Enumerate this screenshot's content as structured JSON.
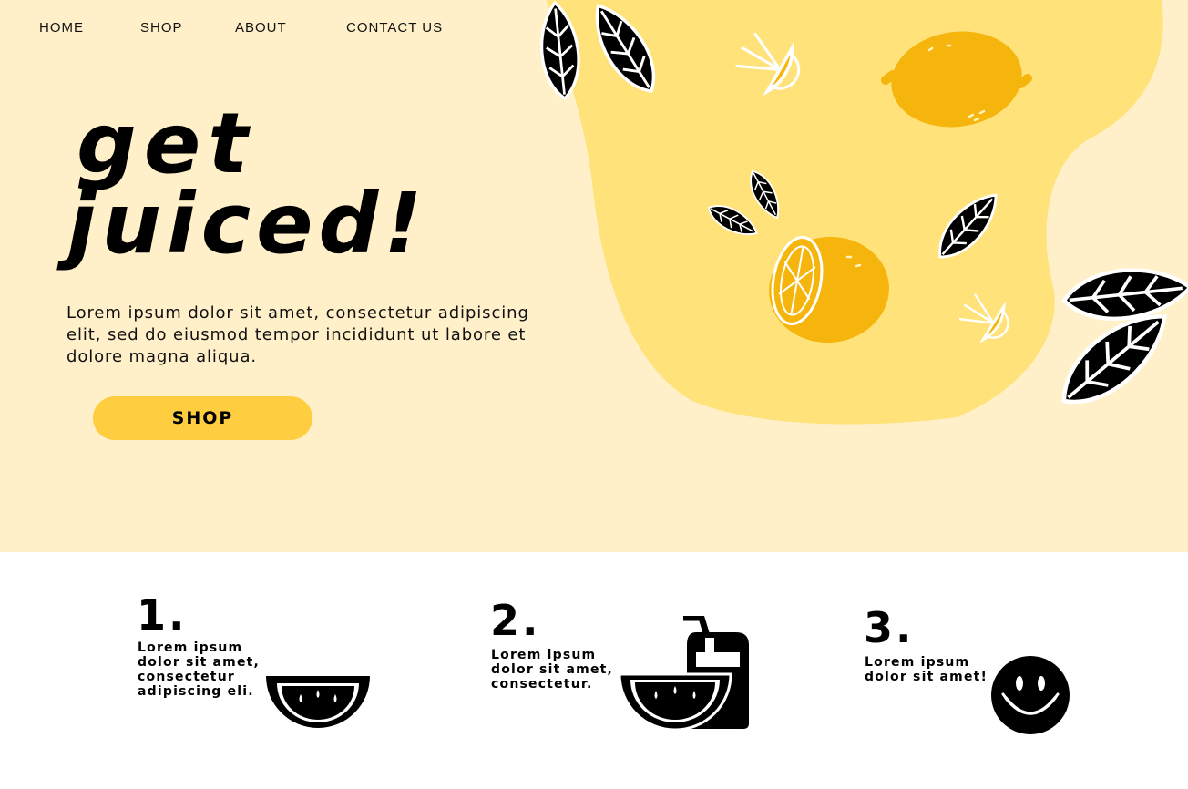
{
  "nav": {
    "home": "HOME",
    "shop": "SHOP",
    "about": "ABOUT",
    "contact": "CONTACT US"
  },
  "hero": {
    "headline_line1": "get",
    "headline_line2": "juiced!",
    "description": "Lorem ipsum dolor sit amet, consectetur adipiscing elit, sed do eiusmod tempor incididunt ut labore et dolore magna aliqua.",
    "cta_label": "SHOP"
  },
  "steps": [
    {
      "number": "1.",
      "text": "Lorem ipsum\ndolor sit amet,\nconsectetur\nadipiscing eli.",
      "icon": "watermelon-slice-icon"
    },
    {
      "number": "2.",
      "text": "Lorem ipsum\ndolor sit amet,\nconsectetur.",
      "icon": "juice-glass-icon"
    },
    {
      "number": "3.",
      "text": "Lorem ipsum\ndolor sit amet!",
      "icon": "smiley-face-icon"
    }
  ],
  "colors": {
    "hero_background": "#fff0c9",
    "blob": "#ffe27a",
    "lemon": "#f6b50c",
    "button": "#ffcd40",
    "ink": "#000000"
  }
}
